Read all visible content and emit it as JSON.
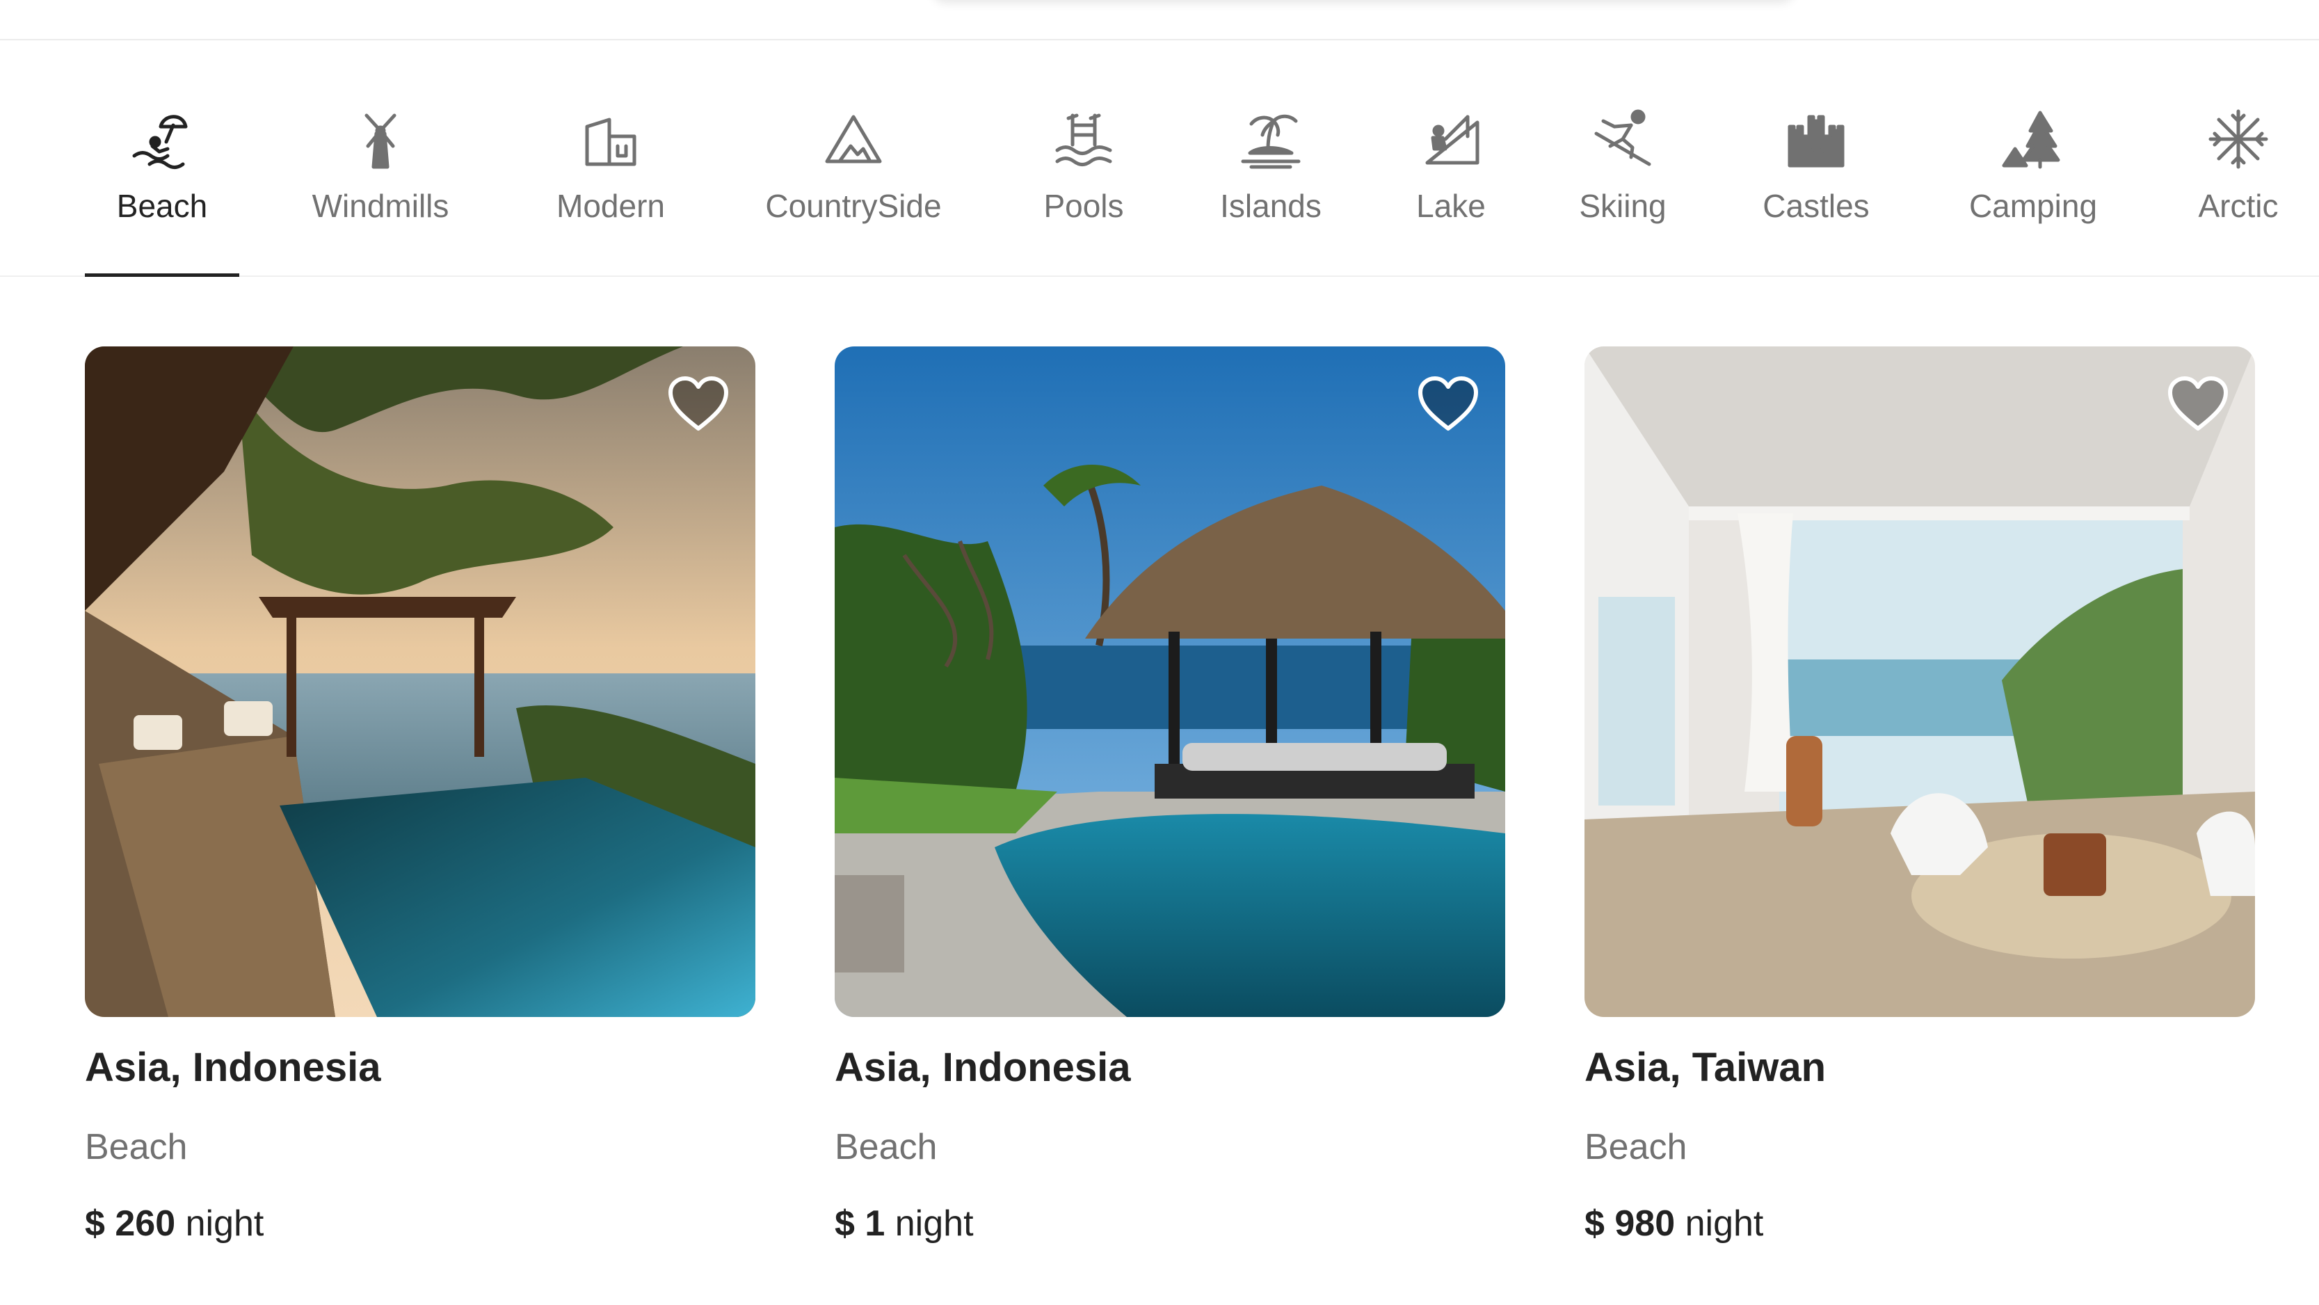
{
  "categories": [
    {
      "label": "Beach",
      "icon": "beach-umbrella-icon",
      "active": true
    },
    {
      "label": "Windmills",
      "icon": "windmill-icon",
      "active": false
    },
    {
      "label": "Modern",
      "icon": "modern-building-icon",
      "active": false
    },
    {
      "label": "CountrySide",
      "icon": "mountain-icon",
      "active": false
    },
    {
      "label": "Pools",
      "icon": "pool-ladder-icon",
      "active": false
    },
    {
      "label": "Islands",
      "icon": "island-palm-icon",
      "active": false
    },
    {
      "label": "Lake",
      "icon": "lake-fishing-icon",
      "active": false
    },
    {
      "label": "Skiing",
      "icon": "skier-icon",
      "active": false
    },
    {
      "label": "Castles",
      "icon": "castle-icon",
      "active": false
    },
    {
      "label": "Camping",
      "icon": "tent-tree-icon",
      "active": false
    },
    {
      "label": "Arctic",
      "icon": "snowflake-icon",
      "active": false
    }
  ],
  "listings": [
    {
      "location": "Asia, Indonesia",
      "category": "Beach",
      "currency": "$",
      "price": "260",
      "unit": "night",
      "favorite_icon": "heart-icon"
    },
    {
      "location": "Asia, Indonesia",
      "category": "Beach",
      "currency": "$",
      "price": "1",
      "unit": "night",
      "favorite_icon": "heart-icon"
    },
    {
      "location": "Asia, Taiwan",
      "category": "Beach",
      "currency": "$",
      "price": "980",
      "unit": "night",
      "favorite_icon": "heart-icon"
    }
  ],
  "colors": {
    "text_primary": "#222222",
    "text_secondary": "#717171",
    "divider": "#ebebeb",
    "background": "#ffffff"
  }
}
